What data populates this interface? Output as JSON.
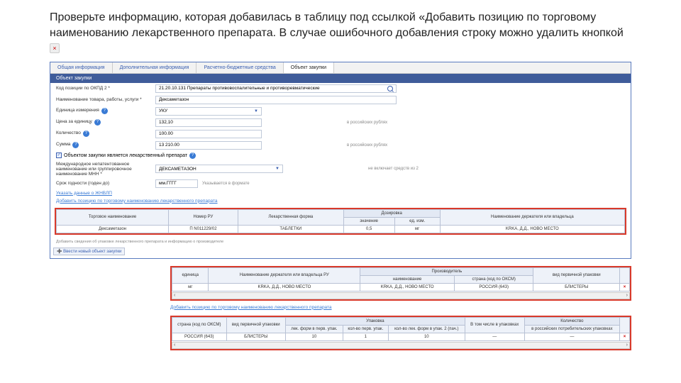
{
  "note": "Проверьте информацию, которая добавилась в таблицу под ссылкой «Добавить позицию по торговому наименованию лекарственного препарата. В случае ошибочного добавления строку можно удалить кнопкой",
  "tabs": {
    "t1": "Общая информация",
    "t2": "Дополнительная информация",
    "t3": "Расчетно-бюджетные средства",
    "t4": "Объект закупки"
  },
  "sec": "Объект закупки",
  "f": {
    "okpd_l": "Код позиции по ОКПД 2 *",
    "okpd_v": "21.20.10.131 Препараты противовоспалительные и противоревматические",
    "name_l": "Наименование товара, работы, услуги *",
    "name_v": "Дексаметазон",
    "curr_l": "Единица измерения",
    "curr_v": "УКУ",
    "price_l": "Цена за единицу",
    "price_v": "132,10",
    "price_h": "в российских рублях",
    "qty_l": "Количество",
    "qty_v": "100.00",
    "sum_l": "Сумма",
    "sum_v": "13 210.00",
    "sum_h": "в российских рублях",
    "chk1": "Объектом закупки является лекарственный препарат",
    "mnn_l": "Международное непатентованное наименование или группировочное наименование МНН *",
    "mnn_v": "ДЕКСАМЕТАЗОН",
    "mnn_h": "не включает средств из 2",
    "dose_l": "Срок годности (годен до)",
    "dose_v": "мм.ГГГГ",
    "dose_h": "Указывается в формате",
    "jmax": "Указать данные о ЖНВЛП"
  },
  "addlink": "Добавить позицию по торговому наименованию лекарственного препарата",
  "tblA": {
    "h1": "Торговое наименование",
    "h2": "Номер РУ",
    "h3": "Лекарственная форма",
    "hg": "Дозировка",
    "h4": "значение",
    "h5": "ед. изм.",
    "h6": "Наименование держателя или владельца",
    "r1": "Дексаметазон",
    "r2": "П N011229/02",
    "r3": "ТАБЛЕТКИ",
    "r4": "0,5",
    "r5": "мг",
    "r6": "KRKA, Д.Д., НОВО МЕСТО"
  },
  "note2": "Добавить сведения об упаковке лекарственного препарата и информацию о производителе",
  "tblB": {
    "hg": "Производитель",
    "h1": "единица",
    "h2": "Наименование держателя или владельца РУ",
    "h3": "наименование",
    "h4": "страна (код по ОКСМ)",
    "h5": "вид первичной упаковки",
    "r1": "мг",
    "r2": "KRKA, Д.Д., НОВО МЕСТО",
    "r3": "KRKA, Д.Д., НОВО МЕСТО",
    "r4": "РОССИЯ (643)",
    "r5": "БЛИСТЕРЫ"
  },
  "addlink2": "Добавить позицию по торговому наименованию лекарственного препарата",
  "tblC": {
    "g1": "Упаковка",
    "g2": "Количество",
    "h1": "страна (код по ОКСМ)",
    "h2": "вид первичной упаковки",
    "h3": "лек. форм в перв. упак.",
    "h4": "кол-во перв. упак.",
    "h5": "кол-во лек. форм в упак. 2 (пач.)",
    "h6": "В том числе в упаковках",
    "h7": "в российских потребительских упаковках",
    "r1": "РОССИЯ (643)",
    "r2": "БЛИСТЕРЫ",
    "r3": "10",
    "r4": "1",
    "r5": "10",
    "r6": "—",
    "r7": "—"
  }
}
